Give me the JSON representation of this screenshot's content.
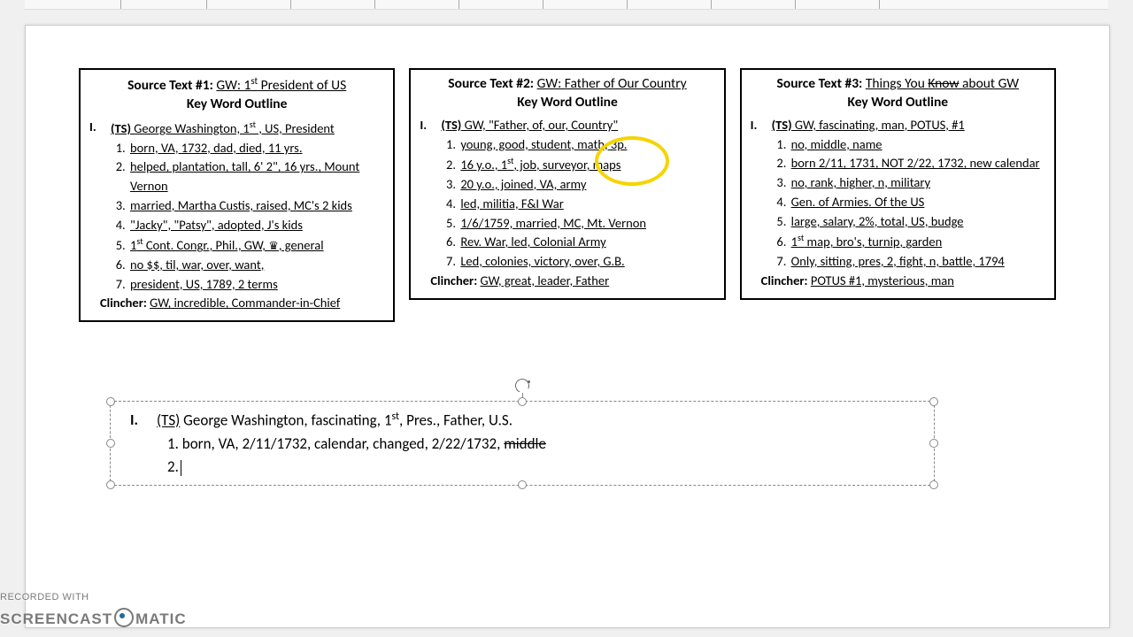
{
  "cards": [
    {
      "label": "Source Text #1:",
      "link_pre": "GW: 1",
      "link_sup": "st",
      "link_post": " President of US",
      "kwo": "Key Word Outline",
      "roman": "I.",
      "ts_label": "(TS)",
      "ts_pre": " George Washington, 1",
      "ts_sup": "st",
      "ts_post": " , US, President",
      "items": [
        "born, VA, 1732, dad, died, 11 yrs.",
        "helped, plantation, tall, 6' 2\", 16 yrs., Mount Vernon",
        "married, Martha Custis, raised, MC's 2 kids",
        "\"Jacky\", \"Patsy\", adopted, J's kids",
        "1st Cont. Congr., Phil., GW, ♛, general",
        "no $$, til, war, over, want,",
        "president, US, 1789, 2 terms"
      ],
      "clincher_label": "Clincher:",
      "clincher_text": "GW, incredible, Commander-in-Chief"
    },
    {
      "label": "Source Text #2:",
      "link": "GW: Father of Our Country",
      "kwo": "Key Word Outline",
      "roman": "I.",
      "ts_label": "(TS)",
      "ts_text": " GW, \"Father, of, our, Country\"",
      "items": [
        "young, good, student, math, 3p.",
        "16 y.o., 1st, job, surveyor, maps",
        "20 y.o., joined, VA, army",
        "led, militia, F&I War",
        "1/6/1759, married, MC, Mt. Vernon",
        "Rev. War, led, Colonial Army",
        "Led, colonies, victory, over, G.B."
      ],
      "clincher_label": "Clincher:",
      "clincher_text": "GW, great, leader, Father"
    },
    {
      "label": "Source Text #3:",
      "link_pre": "Things You ",
      "link_strike": "Know",
      "link_post": " about GW",
      "kwo": "Key Word Outline",
      "roman": "I.",
      "ts_label": "(TS)",
      "ts_text": " GW, fascinating, man, POTUS, #1",
      "items": [
        "no, middle, name",
        "born 2/11, 1731, NOT 2/22, 1732, new calendar",
        "no, rank, higher, n, military",
        "Gen. of Armies. Of the US",
        "large, salary, 2%, total, US, budge",
        "1st map, bro's, turnip, garden",
        "Only, sitting, pres, 2, fight, n, battle, 1794"
      ],
      "clincher_label": "Clincher:",
      "clincher_text": "POTUS #1, mysterious, man"
    }
  ],
  "textbox": {
    "roman": "I.",
    "ts_label": "(TS)",
    "ts_pre": " George Washington, fascinating, 1",
    "ts_sup": "st",
    "ts_post": ", Pres., Father, U.S.",
    "line1_num": "1.",
    "line1_text": " born, VA, 2/11/1732, calendar, changed, 2/22/1732, ",
    "line1_strike": "middle",
    "line2_num": "2."
  },
  "watermark": {
    "top": "RECORDED WITH",
    "left": "SCREENCAST",
    "right": "MATIC"
  }
}
